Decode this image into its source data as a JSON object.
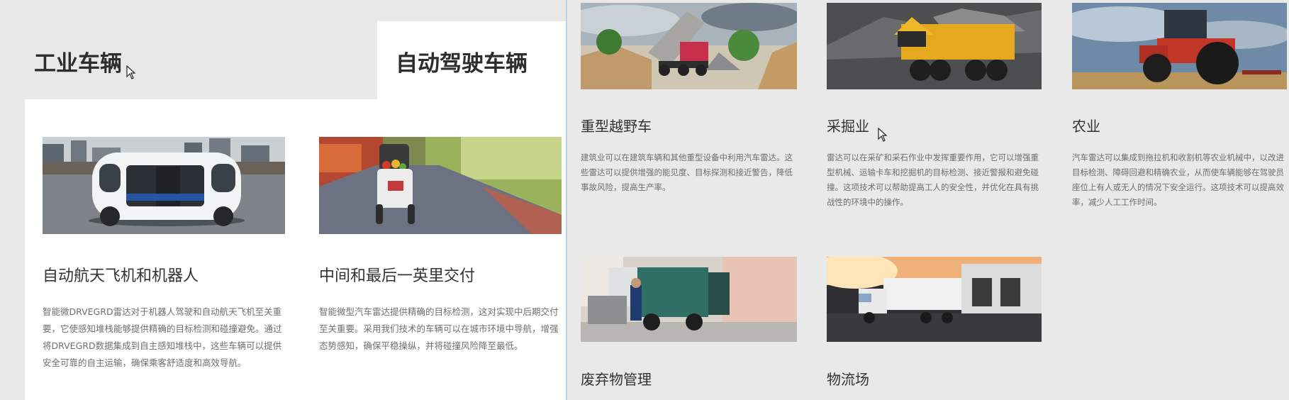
{
  "tabs": {
    "industrial_label": "工业车辆",
    "autonomous_label": "自动驾驶车辆"
  },
  "left_cards": [
    {
      "title": "自动航天飞机和机器人",
      "desc": "智能微DRVEGRD雷达对于机器人驾驶和自动航天飞机至关重要，它使感知堆栈能够提供精确的目标检测和碰撞避免。通过将DRVEGRD数据集成到自主感知堆栈中，这些车辆可以提供安全可靠的自主运输，确保乘客舒适度和高效导航。"
    },
    {
      "title": "中间和最后一英里交付",
      "desc": "智能微型汽车雷达提供精确的目标检测，这对实现中后期交付至关重要。采用我们技术的车辆可以在城市环境中导航，增强态势感知，确保平稳操纵，并将碰撞风险降至最低。"
    }
  ],
  "right_cards": [
    {
      "title": "重型越野车",
      "desc": "建筑业可以在建筑车辆和其他重型设备中利用汽车雷达。这些雷达可以提供增强的能见度、目标探测和接近警告，降低事故风险，提高生产率。"
    },
    {
      "title": "采掘业",
      "desc": "雷达可以在采矿和采石作业中发挥重要作用，它可以增强重型机械、运输卡车和挖掘机的目标检测、接近警报和避免碰撞。这项技术可以帮助提高工人的安全性，并优化在具有挑战性的环境中的操作。"
    },
    {
      "title": "农业",
      "desc": "汽车雷达可以集成到拖拉机和收割机等农业机械中，以改进目标检测、障碍回避和精确农业，从而使车辆能够在驾驶员座位上有人或无人的情况下安全运行。这项技术可以提高效率，减少人工工作时间。"
    },
    {
      "title": "废弃物管理",
      "desc": ""
    },
    {
      "title": "物流场",
      "desc": ""
    }
  ]
}
